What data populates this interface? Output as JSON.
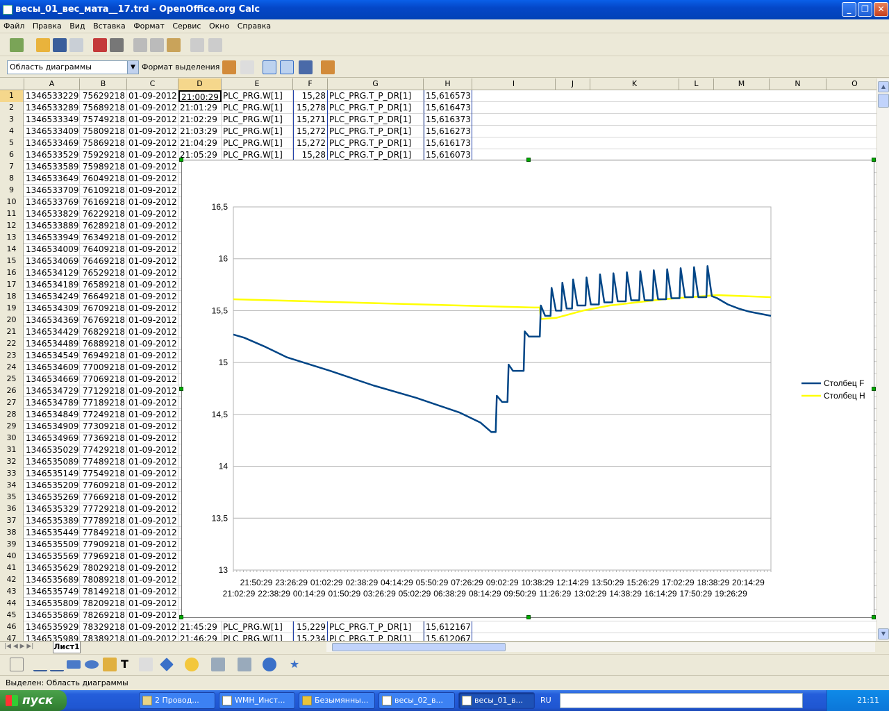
{
  "window": {
    "title": "весы_01_вес_мата__17.trd - OpenOffice.org Calc"
  },
  "menu": [
    "Файл",
    "Правка",
    "Вид",
    "Вставка",
    "Формат",
    "Сервис",
    "Окно",
    "Справка"
  ],
  "toolbar2": {
    "area_combo": "Область диаграммы",
    "format_selection": "Формат выделения"
  },
  "columns": [
    "A",
    "B",
    "C",
    "D",
    "E",
    "F",
    "G",
    "H",
    "I",
    "J",
    "K",
    "L",
    "M",
    "N",
    "O"
  ],
  "top_rows": [
    {
      "n": "1",
      "a": "1346533229",
      "b": "75629218",
      "c": "01-09-2012",
      "d": "21:00:29",
      "e": "PLC_PRG.W[1]",
      "f": "15,28",
      "g": "PLC_PRG.T_P_DR[1]",
      "h": "15,616573"
    },
    {
      "n": "2",
      "a": "1346533289",
      "b": "75689218",
      "c": "01-09-2012",
      "d": "21:01:29",
      "e": "PLC_PRG.W[1]",
      "f": "15,278",
      "g": "PLC_PRG.T_P_DR[1]",
      "h": "15,616473"
    },
    {
      "n": "3",
      "a": "1346533349",
      "b": "75749218",
      "c": "01-09-2012",
      "d": "21:02:29",
      "e": "PLC_PRG.W[1]",
      "f": "15,271",
      "g": "PLC_PRG.T_P_DR[1]",
      "h": "15,616373"
    },
    {
      "n": "4",
      "a": "1346533409",
      "b": "75809218",
      "c": "01-09-2012",
      "d": "21:03:29",
      "e": "PLC_PRG.W[1]",
      "f": "15,272",
      "g": "PLC_PRG.T_P_DR[1]",
      "h": "15,616273"
    },
    {
      "n": "5",
      "a": "1346533469",
      "b": "75869218",
      "c": "01-09-2012",
      "d": "21:04:29",
      "e": "PLC_PRG.W[1]",
      "f": "15,272",
      "g": "PLC_PRG.T_P_DR[1]",
      "h": "15,616173"
    },
    {
      "n": "6",
      "a": "1346533529",
      "b": "75929218",
      "c": "01-09-2012",
      "d": "21:05:29",
      "e": "PLC_PRG.W[1]",
      "f": "15,28",
      "g": "PLC_PRG.T_P_DR[1]",
      "h": "15,616073"
    }
  ],
  "mid_rows": [
    {
      "n": "7",
      "a": "1346533589",
      "b": "75989218",
      "c": "01-09-2012"
    },
    {
      "n": "8",
      "a": "1346533649",
      "b": "76049218",
      "c": "01-09-2012"
    },
    {
      "n": "9",
      "a": "1346533709",
      "b": "76109218",
      "c": "01-09-2012"
    },
    {
      "n": "10",
      "a": "1346533769",
      "b": "76169218",
      "c": "01-09-2012"
    },
    {
      "n": "11",
      "a": "1346533829",
      "b": "76229218",
      "c": "01-09-2012"
    },
    {
      "n": "12",
      "a": "1346533889",
      "b": "76289218",
      "c": "01-09-2012"
    },
    {
      "n": "13",
      "a": "1346533949",
      "b": "76349218",
      "c": "01-09-2012"
    },
    {
      "n": "14",
      "a": "1346534009",
      "b": "76409218",
      "c": "01-09-2012"
    },
    {
      "n": "15",
      "a": "1346534069",
      "b": "76469218",
      "c": "01-09-2012"
    },
    {
      "n": "16",
      "a": "1346534129",
      "b": "76529218",
      "c": "01-09-2012"
    },
    {
      "n": "17",
      "a": "1346534189",
      "b": "76589218",
      "c": "01-09-2012"
    },
    {
      "n": "18",
      "a": "1346534249",
      "b": "76649218",
      "c": "01-09-2012"
    },
    {
      "n": "19",
      "a": "1346534309",
      "b": "76709218",
      "c": "01-09-2012"
    },
    {
      "n": "20",
      "a": "1346534369",
      "b": "76769218",
      "c": "01-09-2012"
    },
    {
      "n": "21",
      "a": "1346534429",
      "b": "76829218",
      "c": "01-09-2012"
    },
    {
      "n": "22",
      "a": "1346534489",
      "b": "76889218",
      "c": "01-09-2012"
    },
    {
      "n": "23",
      "a": "1346534549",
      "b": "76949218",
      "c": "01-09-2012"
    },
    {
      "n": "24",
      "a": "1346534609",
      "b": "77009218",
      "c": "01-09-2012"
    },
    {
      "n": "25",
      "a": "1346534669",
      "b": "77069218",
      "c": "01-09-2012"
    },
    {
      "n": "26",
      "a": "1346534729",
      "b": "77129218",
      "c": "01-09-2012"
    },
    {
      "n": "27",
      "a": "1346534789",
      "b": "77189218",
      "c": "01-09-2012"
    },
    {
      "n": "28",
      "a": "1346534849",
      "b": "77249218",
      "c": "01-09-2012"
    },
    {
      "n": "29",
      "a": "1346534909",
      "b": "77309218",
      "c": "01-09-2012"
    },
    {
      "n": "30",
      "a": "1346534969",
      "b": "77369218",
      "c": "01-09-2012"
    },
    {
      "n": "31",
      "a": "1346535029",
      "b": "77429218",
      "c": "01-09-2012"
    },
    {
      "n": "32",
      "a": "1346535089",
      "b": "77489218",
      "c": "01-09-2012"
    },
    {
      "n": "33",
      "a": "1346535149",
      "b": "77549218",
      "c": "01-09-2012"
    },
    {
      "n": "34",
      "a": "1346535209",
      "b": "77609218",
      "c": "01-09-2012"
    },
    {
      "n": "35",
      "a": "1346535269",
      "b": "77669218",
      "c": "01-09-2012"
    },
    {
      "n": "36",
      "a": "1346535329",
      "b": "77729218",
      "c": "01-09-2012"
    },
    {
      "n": "37",
      "a": "1346535389",
      "b": "77789218",
      "c": "01-09-2012"
    },
    {
      "n": "38",
      "a": "1346535449",
      "b": "77849218",
      "c": "01-09-2012"
    },
    {
      "n": "39",
      "a": "1346535509",
      "b": "77909218",
      "c": "01-09-2012"
    },
    {
      "n": "40",
      "a": "1346535569",
      "b": "77969218",
      "c": "01-09-2012"
    },
    {
      "n": "41",
      "a": "1346535629",
      "b": "78029218",
      "c": "01-09-2012"
    },
    {
      "n": "42",
      "a": "1346535689",
      "b": "78089218",
      "c": "01-09-2012"
    },
    {
      "n": "43",
      "a": "1346535749",
      "b": "78149218",
      "c": "01-09-2012"
    },
    {
      "n": "44",
      "a": "1346535809",
      "b": "78209218",
      "c": "01-09-2012"
    },
    {
      "n": "45",
      "a": "1346535869",
      "b": "78269218",
      "c": "01-09-2012"
    }
  ],
  "bottom_rows": [
    {
      "n": "46",
      "a": "1346535929",
      "b": "78329218",
      "c": "01-09-2012",
      "d": "21:45:29",
      "e": "PLC_PRG.W[1]",
      "f": "15,229",
      "g": "PLC_PRG.T_P_DR[1]",
      "h": "15,612167"
    },
    {
      "n": "47",
      "a": "1346535989",
      "b": "78389218",
      "c": "01-09-2012",
      "d": "21:46:29",
      "e": "PLC_PRG.W[1]",
      "f": "15,234",
      "g": "PLC_PRG.T_P_DR[1]",
      "h": "15,612067"
    }
  ],
  "sheet_tab": "Лист1",
  "status": "Выделен: Область диаграммы",
  "taskbar": {
    "start": "пуск",
    "tasks": [
      "2 Провод...",
      "WMH_Инст...",
      "Безымянны...",
      "весы_02_в...",
      "весы_01_в..."
    ],
    "lang": "RU",
    "clock": "21:11"
  },
  "chart_data": {
    "type": "line",
    "ylim": [
      13,
      16.5
    ],
    "yticks": [
      "13",
      "13,5",
      "14",
      "14,5",
      "15",
      "15,5",
      "16",
      "16,5"
    ],
    "xticks_top": [
      "21:50:29",
      "23:26:29",
      "01:02:29",
      "02:38:29",
      "04:14:29",
      "05:50:29",
      "07:26:29",
      "09:02:29",
      "10:38:29",
      "12:14:29",
      "13:50:29",
      "15:26:29",
      "17:02:29",
      "18:38:29",
      "20:14:29"
    ],
    "xticks_bottom": [
      "21:02:29",
      "22:38:29",
      "00:14:29",
      "01:50:29",
      "03:26:29",
      "05:02:29",
      "06:38:29",
      "08:14:29",
      "09:50:29",
      "11:26:29",
      "13:02:29",
      "14:38:29",
      "16:14:29",
      "17:50:29",
      "19:26:29"
    ],
    "series": [
      {
        "name": "Столбец F",
        "color": "#004586",
        "x": [
          0,
          0.02,
          0.06,
          0.1,
          0.18,
          0.26,
          0.34,
          0.42,
          0.46,
          0.48,
          0.488,
          0.49,
          0.5,
          0.51,
          0.512,
          0.52,
          0.54,
          0.542,
          0.55,
          0.57,
          0.572,
          0.58,
          0.59,
          0.592,
          0.6,
          0.61,
          0.612,
          0.62,
          0.63,
          0.632,
          0.64,
          0.655,
          0.657,
          0.665,
          0.68,
          0.682,
          0.69,
          0.705,
          0.707,
          0.715,
          0.73,
          0.732,
          0.74,
          0.755,
          0.757,
          0.765,
          0.78,
          0.782,
          0.79,
          0.805,
          0.807,
          0.815,
          0.83,
          0.832,
          0.84,
          0.855,
          0.857,
          0.865,
          0.88,
          0.882,
          0.89,
          0.9,
          0.92,
          0.94,
          0.96,
          0.98,
          1.0
        ],
        "y": [
          15.27,
          15.24,
          15.15,
          15.05,
          14.92,
          14.78,
          14.66,
          14.52,
          14.42,
          14.33,
          14.33,
          14.68,
          14.62,
          14.62,
          14.98,
          14.92,
          14.92,
          15.3,
          15.25,
          15.25,
          15.55,
          15.45,
          15.45,
          15.72,
          15.5,
          15.5,
          15.77,
          15.52,
          15.52,
          15.8,
          15.55,
          15.55,
          15.82,
          15.56,
          15.56,
          15.85,
          15.58,
          15.58,
          15.86,
          15.59,
          15.59,
          15.87,
          15.6,
          15.6,
          15.88,
          15.6,
          15.6,
          15.89,
          15.61,
          15.61,
          15.9,
          15.62,
          15.62,
          15.91,
          15.63,
          15.63,
          15.92,
          15.63,
          15.63,
          15.93,
          15.64,
          15.62,
          15.56,
          15.52,
          15.49,
          15.47,
          15.45
        ]
      },
      {
        "name": "Столбец H",
        "color": "#ffff00",
        "x": [
          0,
          0.56,
          0.57,
          0.572,
          0.6,
          0.65,
          0.7,
          0.75,
          0.8,
          0.85,
          0.9,
          0.95,
          1.0
        ],
        "y": [
          15.61,
          15.53,
          15.53,
          15.42,
          15.43,
          15.5,
          15.55,
          15.58,
          15.61,
          15.63,
          15.65,
          15.64,
          15.63
        ]
      }
    ]
  }
}
